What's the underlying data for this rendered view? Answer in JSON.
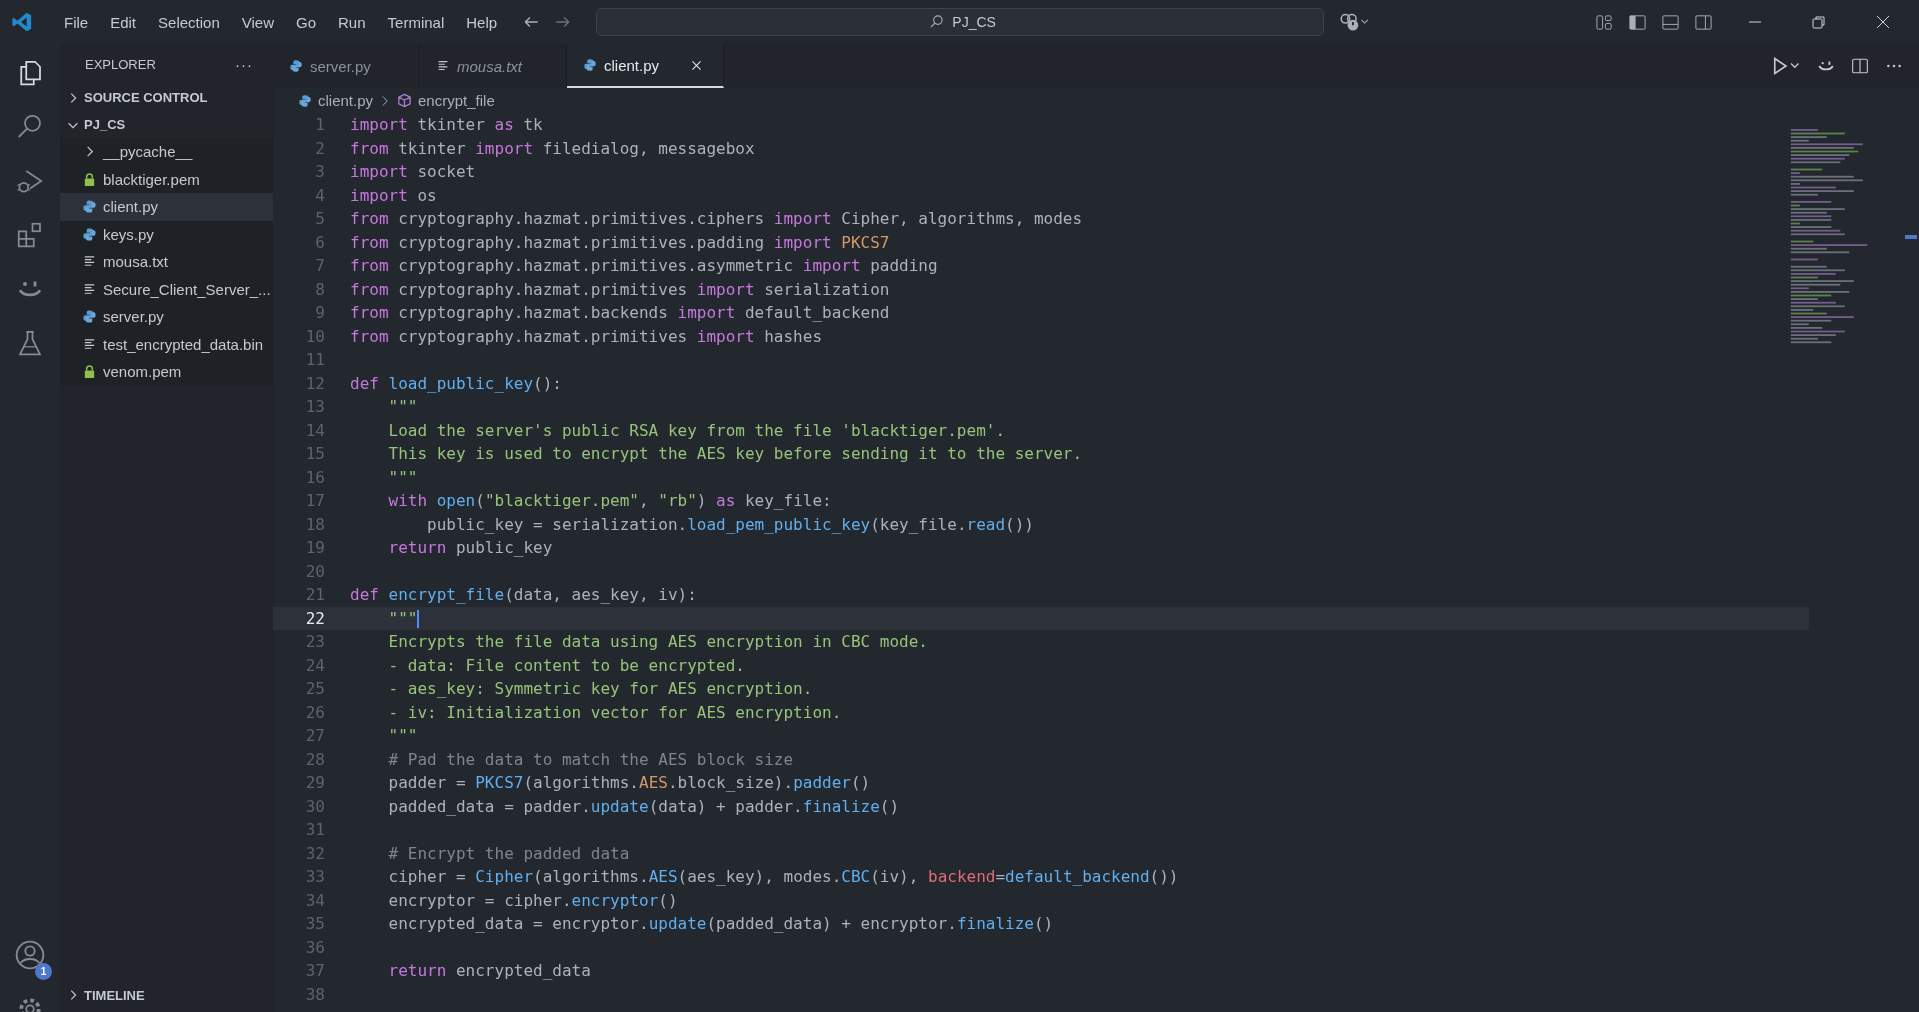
{
  "menu": [
    "File",
    "Edit",
    "Selection",
    "View",
    "Go",
    "Run",
    "Terminal",
    "Help"
  ],
  "command_center": {
    "placeholder": "PJ_CS"
  },
  "activity_bar": {
    "account_badge": "1"
  },
  "sidebar": {
    "title": "EXPLORER",
    "more": "···",
    "sections": [
      {
        "label": "SOURCE CONTROL",
        "expanded": false
      },
      {
        "label": "PJ_CS",
        "expanded": true,
        "items": [
          {
            "kind": "folder",
            "name": "__pycache__",
            "expanded": false,
            "selected": false
          },
          {
            "kind": "key",
            "name": "blacktiger.pem",
            "selected": false
          },
          {
            "kind": "python",
            "name": "client.py",
            "selected": true
          },
          {
            "kind": "python",
            "name": "keys.py",
            "selected": false
          },
          {
            "kind": "text",
            "name": "mousa.txt",
            "selected": false
          },
          {
            "kind": "text",
            "name": "Secure_Client_Server_...",
            "selected": false
          },
          {
            "kind": "python",
            "name": "server.py",
            "selected": false
          },
          {
            "kind": "text",
            "name": "test_encrypted_data.bin",
            "selected": false
          },
          {
            "kind": "key",
            "name": "venom.pem",
            "selected": false
          }
        ]
      },
      {
        "label": "TIMELINE",
        "expanded": false
      }
    ]
  },
  "tabs": [
    {
      "kind": "python",
      "label": "server.py",
      "selected": false,
      "preview": false
    },
    {
      "kind": "text",
      "label": "mousa.txt",
      "selected": false,
      "preview": true
    },
    {
      "kind": "python",
      "label": "client.py",
      "selected": true,
      "preview": false
    }
  ],
  "breadcrumb": [
    "client.py",
    "encrypt_file"
  ],
  "code": [
    {
      "number": "1",
      "current": false,
      "tokens": [
        {
          "kind": "keyword",
          "text": "import"
        },
        {
          "kind": "plain",
          "text": " tkinter "
        },
        {
          "kind": "keyword",
          "text": "as"
        },
        {
          "kind": "plain",
          "text": " tk"
        }
      ]
    },
    {
      "number": "2",
      "current": false,
      "tokens": [
        {
          "kind": "keyword",
          "text": "from"
        },
        {
          "kind": "plain",
          "text": " tkinter "
        },
        {
          "kind": "keyword",
          "text": "import"
        },
        {
          "kind": "plain",
          "text": " filedialog, messagebox"
        }
      ]
    },
    {
      "number": "3",
      "current": false,
      "tokens": [
        {
          "kind": "keyword",
          "text": "import"
        },
        {
          "kind": "plain",
          "text": " socket"
        }
      ]
    },
    {
      "number": "4",
      "current": false,
      "tokens": [
        {
          "kind": "keyword",
          "text": "import"
        },
        {
          "kind": "plain",
          "text": " os"
        }
      ]
    },
    {
      "number": "5",
      "current": false,
      "tokens": [
        {
          "kind": "keyword",
          "text": "from"
        },
        {
          "kind": "plain",
          "text": " cryptography.hazmat.primitives.ciphers "
        },
        {
          "kind": "keyword",
          "text": "import"
        },
        {
          "kind": "plain",
          "text": " Cipher, algorithms, modes"
        }
      ]
    },
    {
      "number": "6",
      "current": false,
      "tokens": [
        {
          "kind": "keyword",
          "text": "from"
        },
        {
          "kind": "plain",
          "text": " cryptography.hazmat.primitives.padding "
        },
        {
          "kind": "keyword",
          "text": "import"
        },
        {
          "kind": "constant",
          "text": " PKCS7"
        }
      ]
    },
    {
      "number": "7",
      "current": false,
      "tokens": [
        {
          "kind": "keyword",
          "text": "from"
        },
        {
          "kind": "plain",
          "text": " cryptography.hazmat.primitives.asymmetric "
        },
        {
          "kind": "keyword",
          "text": "import"
        },
        {
          "kind": "plain",
          "text": " padding"
        }
      ]
    },
    {
      "number": "8",
      "current": false,
      "tokens": [
        {
          "kind": "keyword",
          "text": "from"
        },
        {
          "kind": "plain",
          "text": " cryptography.hazmat.primitives "
        },
        {
          "kind": "keyword",
          "text": "import"
        },
        {
          "kind": "plain",
          "text": " serialization"
        }
      ]
    },
    {
      "number": "9",
      "current": false,
      "tokens": [
        {
          "kind": "keyword",
          "text": "from"
        },
        {
          "kind": "plain",
          "text": " cryptography.hazmat.backends "
        },
        {
          "kind": "keyword",
          "text": "import"
        },
        {
          "kind": "plain",
          "text": " default_backend"
        }
      ]
    },
    {
      "number": "10",
      "current": false,
      "tokens": [
        {
          "kind": "keyword",
          "text": "from"
        },
        {
          "kind": "plain",
          "text": " cryptography.hazmat.primitives "
        },
        {
          "kind": "keyword",
          "text": "import"
        },
        {
          "kind": "plain",
          "text": " hashes"
        }
      ]
    },
    {
      "number": "11",
      "current": false
    },
    {
      "number": "12",
      "current": false,
      "tokens": [
        {
          "kind": "keyword",
          "text": "def"
        },
        {
          "kind": "function",
          "text": " load_public_key"
        },
        {
          "kind": "plain",
          "text": "():"
        }
      ]
    },
    {
      "number": "13",
      "current": false,
      "tokens": [
        {
          "kind": "string",
          "text": "    \"\"\""
        }
      ]
    },
    {
      "number": "14",
      "current": false,
      "tokens": [
        {
          "kind": "string",
          "text": "    Load the server's public RSA key from the file 'blacktiger.pem'."
        }
      ]
    },
    {
      "number": "15",
      "current": false,
      "tokens": [
        {
          "kind": "string",
          "text": "    This key is used to encrypt the AES key before sending it to the server."
        }
      ]
    },
    {
      "number": "16",
      "current": false,
      "tokens": [
        {
          "kind": "string",
          "text": "    \"\"\""
        }
      ]
    },
    {
      "number": "17",
      "current": false,
      "tokens": [
        {
          "kind": "keyword",
          "text": "    with"
        },
        {
          "kind": "function",
          "text": " open"
        },
        {
          "kind": "plain",
          "text": "("
        },
        {
          "kind": "string",
          "text": "\"blacktiger.pem\""
        },
        {
          "kind": "plain",
          "text": ", "
        },
        {
          "kind": "string",
          "text": "\"rb\""
        },
        {
          "kind": "plain",
          "text": ") "
        },
        {
          "kind": "keyword",
          "text": "as"
        },
        {
          "kind": "plain",
          "text": " key_file:"
        }
      ]
    },
    {
      "number": "18",
      "current": false,
      "tokens": [
        {
          "kind": "plain",
          "text": "        public_key = serialization."
        },
        {
          "kind": "function",
          "text": "load_pem_public_key"
        },
        {
          "kind": "plain",
          "text": "(key_file."
        },
        {
          "kind": "function",
          "text": "read"
        },
        {
          "kind": "plain",
          "text": "())"
        }
      ]
    },
    {
      "number": "19",
      "current": false,
      "tokens": [
        {
          "kind": "keyword",
          "text": "    return"
        },
        {
          "kind": "plain",
          "text": " public_key"
        }
      ]
    },
    {
      "number": "20",
      "current": false
    },
    {
      "number": "21",
      "current": false,
      "tokens": [
        {
          "kind": "keyword",
          "text": "def"
        },
        {
          "kind": "function",
          "text": " encrypt_file"
        },
        {
          "kind": "plain",
          "text": "(data, aes_key, iv):"
        }
      ]
    },
    {
      "number": "22",
      "current": true,
      "tokens": [
        {
          "kind": "string",
          "text": "    \"\"\""
        }
      ]
    },
    {
      "number": "23",
      "current": false,
      "tokens": [
        {
          "kind": "string",
          "text": "    Encrypts the file data using AES encryption in CBC mode."
        }
      ]
    },
    {
      "number": "24",
      "current": false,
      "tokens": [
        {
          "kind": "string",
          "text": "    - data: File content to be encrypted."
        }
      ]
    },
    {
      "number": "25",
      "current": false,
      "tokens": [
        {
          "kind": "string",
          "text": "    - aes_key: Symmetric key for AES encryption."
        }
      ]
    },
    {
      "number": "26",
      "current": false,
      "tokens": [
        {
          "kind": "string",
          "text": "    - iv: Initialization vector for AES encryption."
        }
      ]
    },
    {
      "number": "27",
      "current": false,
      "tokens": [
        {
          "kind": "string",
          "text": "    \"\"\""
        }
      ]
    },
    {
      "number": "28",
      "current": false,
      "tokens": [
        {
          "kind": "comment",
          "text": "    # Pad the data to match the AES block size"
        }
      ]
    },
    {
      "number": "29",
      "current": false,
      "tokens": [
        {
          "kind": "plain",
          "text": "    padder = "
        },
        {
          "kind": "function",
          "text": "PKCS7"
        },
        {
          "kind": "plain",
          "text": "(algorithms."
        },
        {
          "kind": "constant",
          "text": "AES"
        },
        {
          "kind": "plain",
          "text": ".block_size)."
        },
        {
          "kind": "function",
          "text": "padder"
        },
        {
          "kind": "plain",
          "text": "()"
        }
      ]
    },
    {
      "number": "30",
      "current": false,
      "tokens": [
        {
          "kind": "plain",
          "text": "    padded_data = padder."
        },
        {
          "kind": "function",
          "text": "update"
        },
        {
          "kind": "plain",
          "text": "(data) + padder."
        },
        {
          "kind": "function",
          "text": "finalize"
        },
        {
          "kind": "plain",
          "text": "()"
        }
      ]
    },
    {
      "number": "31",
      "current": false
    },
    {
      "number": "32",
      "current": false,
      "tokens": [
        {
          "kind": "comment",
          "text": "    # Encrypt the padded data"
        }
      ]
    },
    {
      "number": "33",
      "current": false,
      "tokens": [
        {
          "kind": "plain",
          "text": "    cipher = "
        },
        {
          "kind": "function",
          "text": "Cipher"
        },
        {
          "kind": "plain",
          "text": "(algorithms."
        },
        {
          "kind": "function",
          "text": "AES"
        },
        {
          "kind": "plain",
          "text": "(aes_key), modes."
        },
        {
          "kind": "function",
          "text": "CBC"
        },
        {
          "kind": "plain",
          "text": "(iv), "
        },
        {
          "kind": "parameter",
          "text": "backend"
        },
        {
          "kind": "plain",
          "text": "="
        },
        {
          "kind": "function",
          "text": "default_backend"
        },
        {
          "kind": "plain",
          "text": "())"
        }
      ]
    },
    {
      "number": "34",
      "current": false,
      "tokens": [
        {
          "kind": "plain",
          "text": "    encryptor = cipher."
        },
        {
          "kind": "function",
          "text": "encryptor"
        },
        {
          "kind": "plain",
          "text": "()"
        }
      ]
    },
    {
      "number": "35",
      "current": false,
      "tokens": [
        {
          "kind": "plain",
          "text": "    encrypted_data = encryptor."
        },
        {
          "kind": "function",
          "text": "update"
        },
        {
          "kind": "plain",
          "text": "(padded_data) + encryptor."
        },
        {
          "kind": "function",
          "text": "finalize"
        },
        {
          "kind": "plain",
          "text": "()"
        }
      ]
    },
    {
      "number": "36",
      "current": false
    },
    {
      "number": "37",
      "current": false,
      "tokens": [
        {
          "kind": "keyword",
          "text": "    return"
        },
        {
          "kind": "plain",
          "text": " encrypted_data"
        }
      ]
    },
    {
      "number": "38",
      "current": false
    }
  ]
}
